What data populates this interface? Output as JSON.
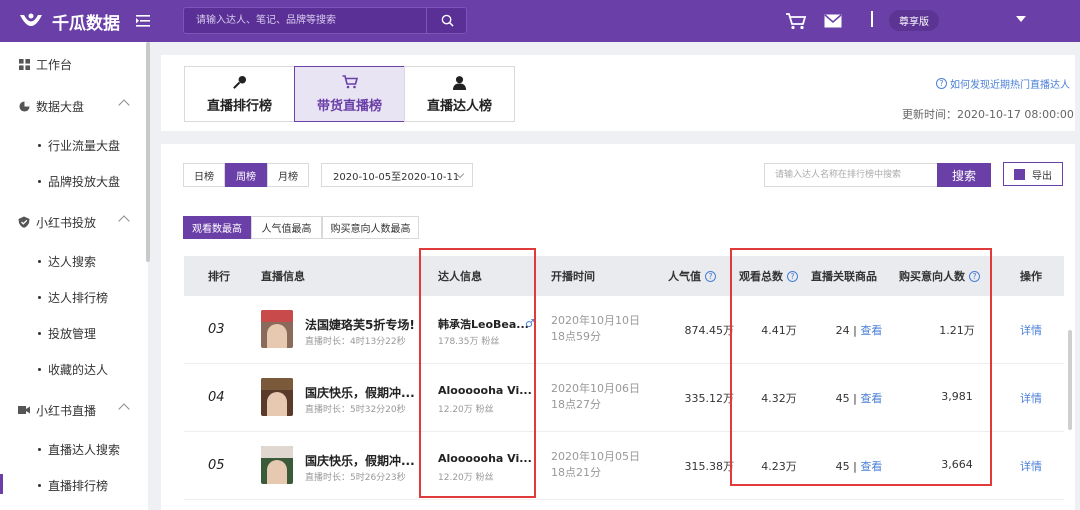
{
  "header": {
    "brand": "千瓜数据",
    "search_placeholder": "请输入达人、笔记、品牌等搜索",
    "plan": "尊享版"
  },
  "sidebar": {
    "items": [
      {
        "label": "工作台"
      },
      {
        "label": "数据大盘"
      },
      {
        "label": "行业流量大盘"
      },
      {
        "label": "品牌投放大盘"
      },
      {
        "label": "小红书投放"
      },
      {
        "label": "达人搜索"
      },
      {
        "label": "达人排行榜"
      },
      {
        "label": "投放管理"
      },
      {
        "label": "收藏的达人"
      },
      {
        "label": "小红书直播"
      },
      {
        "label": "直播达人搜索"
      },
      {
        "label": "直播排行榜"
      }
    ]
  },
  "tabs": {
    "items": [
      {
        "label": "直播排行榜"
      },
      {
        "label": "带货直播榜"
      },
      {
        "label": "直播达人榜"
      }
    ],
    "help": "如何发现近期热门直播达人",
    "update_time": "更新时间：2020-10-17 08:00:00"
  },
  "filters": {
    "periods": [
      "日榜",
      "周榜",
      "月榜"
    ],
    "date_range": "2020-10-05至2020-10-11",
    "search_placeholder": "请输入达人名称在排行榜中搜索",
    "search_label": "搜索",
    "export_label": "导出",
    "sort_tabs": [
      "观看数最高",
      "人气值最高",
      "购买意向人数最高"
    ]
  },
  "table": {
    "headers": [
      "排行",
      "直播信息",
      "达人信息",
      "开播时间",
      "人气值",
      "观看总数",
      "直播关联商品",
      "购买意向人数",
      "操作"
    ],
    "rows": [
      {
        "rank": "03",
        "title": "法国婕珞芙5折专场!",
        "duration": "直播时长：4时13分22秒",
        "kol": "韩承浩LeoBea...",
        "fans": "178.35万 粉丝",
        "gender": "♂",
        "start_date": "2020年10月10日",
        "start_time": "18点59分",
        "popularity": "874.45万",
        "views": "4.41万",
        "goods_count": "24",
        "goods_link": "查看",
        "buyers": "1.21万",
        "action": "详情"
      },
      {
        "rank": "04",
        "title": "国庆快乐，假期冲...",
        "duration": "直播时长：5时32分20秒",
        "kol": "Aloooooha Vi...",
        "fans": "12.20万 粉丝",
        "gender": "",
        "start_date": "2020年10月06日",
        "start_time": "18点27分",
        "popularity": "335.12万",
        "views": "4.32万",
        "goods_count": "45",
        "goods_link": "查看",
        "buyers": "3,981",
        "action": "详情"
      },
      {
        "rank": "05",
        "title": "国庆快乐，假期冲...",
        "duration": "直播时长：5时26分23秒",
        "kol": "Aloooooha Vi...",
        "fans": "12.20万 粉丝",
        "gender": "",
        "start_date": "2020年10月05日",
        "start_time": "18点21分",
        "popularity": "315.38万",
        "views": "4.23万",
        "goods_count": "45",
        "goods_link": "查看",
        "buyers": "3,664",
        "action": "详情"
      }
    ]
  },
  "colors": {
    "brand": "#6a3fa8",
    "link": "#4a7fd6",
    "highlight_box": "#e03a3a"
  }
}
